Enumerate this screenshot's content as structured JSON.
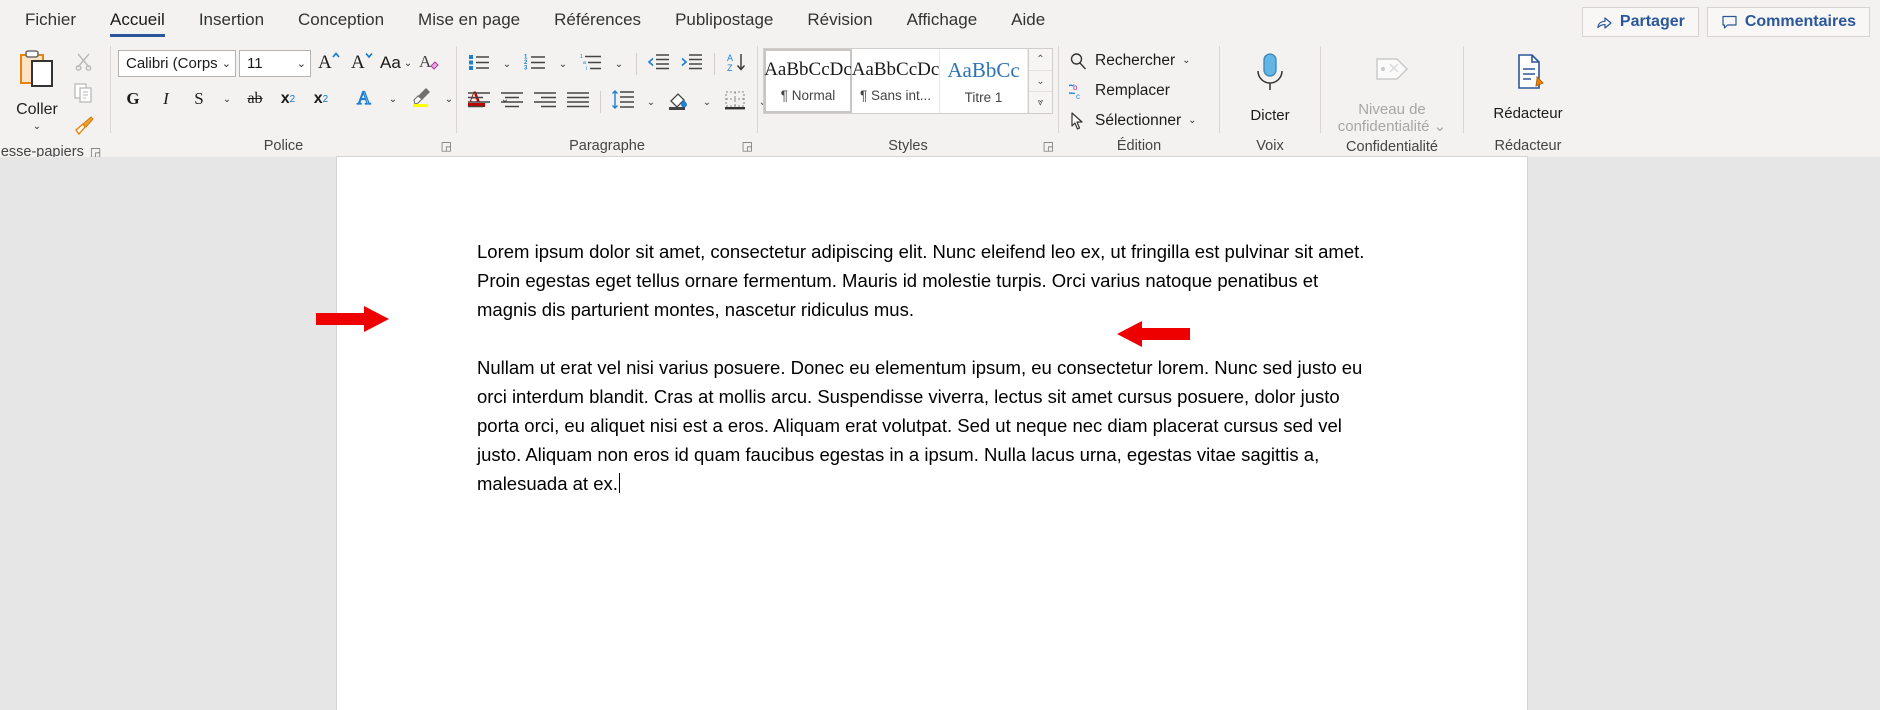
{
  "tabs": [
    {
      "label": "Fichier",
      "active": false
    },
    {
      "label": "Accueil",
      "active": true
    },
    {
      "label": "Insertion",
      "active": false
    },
    {
      "label": "Conception",
      "active": false
    },
    {
      "label": "Mise en page",
      "active": false
    },
    {
      "label": "Références",
      "active": false
    },
    {
      "label": "Publipostage",
      "active": false
    },
    {
      "label": "Révision",
      "active": false
    },
    {
      "label": "Affichage",
      "active": false
    },
    {
      "label": "Aide",
      "active": false
    }
  ],
  "titlebar_buttons": {
    "share": "Partager",
    "share_icon": "share-icon",
    "comments": "Commentaires",
    "comments_icon": "comment-bubble-icon"
  },
  "ribbon": {
    "clipboard": {
      "group_label": "esse-papiers",
      "paste_label": "Coller",
      "paste_icon": "paste-clipboard-icon",
      "paste_caret": "⌄",
      "cut_icon": "scissors-icon",
      "copy_icon": "copy-icon",
      "format_painter_icon": "format-painter-icon",
      "dialog_launcher": "◲"
    },
    "font": {
      "group_label": "Police",
      "font_name": "Calibri (Corps)",
      "font_size": "11",
      "grow_font_icon": "grow-font-icon",
      "shrink_font_icon": "shrink-font-icon",
      "change_case_label": "Aa",
      "change_case_icon": "change-case-icon",
      "clear_format_icon": "clear-formatting-icon",
      "bold_label": "G",
      "italic_label": "I",
      "underline_label": "S",
      "strikethrough_label": "ab",
      "subscript_label": "x",
      "subscript_sub": "2",
      "superscript_label": "x",
      "superscript_sup": "2",
      "text_effects_label": "A",
      "text_effects_icon": "text-effects-icon",
      "highlight_icon": "highlight-color-icon",
      "font_color_label": "A",
      "font_color_icon": "font-color-icon",
      "dialog_launcher": "◲"
    },
    "paragraph": {
      "group_label": "Paragraphe",
      "bullets_icon": "bullet-list-icon",
      "numbering_icon": "numbered-list-icon",
      "multilevel_icon": "multilevel-list-icon",
      "decrease_indent_icon": "decrease-indent-icon",
      "increase_indent_icon": "increase-indent-icon",
      "sort_icon": "sort-az-icon",
      "show_marks_label": "¶",
      "show_marks_icon": "show-paragraph-marks-icon",
      "align_left_icon": "align-left-icon",
      "align_center_icon": "align-center-icon",
      "align_right_icon": "align-right-icon",
      "align_justify_icon": "align-justify-icon",
      "line_spacing_icon": "line-spacing-icon",
      "shading_icon": "shading-icon",
      "borders_icon": "borders-icon",
      "dialog_launcher": "◲"
    },
    "styles": {
      "group_label": "Styles",
      "items": [
        {
          "preview": "AaBbCcDc",
          "name": "¶ Normal",
          "selected": true,
          "blue": false
        },
        {
          "preview": "AaBbCcDc",
          "name": "¶ Sans int...",
          "selected": false,
          "blue": false
        },
        {
          "preview": "AaBbCc",
          "name": "Titre 1",
          "selected": false,
          "blue": true
        }
      ],
      "scroll_up": "⌃",
      "scroll_down": "⌄",
      "more": "⩔",
      "dialog_launcher": "◲"
    },
    "editing": {
      "group_label": "Édition",
      "find_label": "Rechercher",
      "find_icon": "search-icon",
      "find_caret": "⌄",
      "replace_label": "Remplacer",
      "replace_icon": "replace-icon",
      "select_label": "Sélectionner",
      "select_icon": "cursor-arrow-icon",
      "select_caret": "⌄"
    },
    "voice": {
      "group_label": "Voix",
      "dictate_label": "Dicter",
      "dictate_icon": "microphone-icon"
    },
    "confidentiality": {
      "group_label": "Confidentialité",
      "sensitivity_label": "Niveau de confidentialité",
      "sensitivity_icon": "sensitivity-label-icon",
      "caret": "⌄"
    },
    "editor": {
      "group_label": "Rédacteur",
      "editor_label": "Rédacteur",
      "editor_icon": "editor-pencil-icon"
    }
  },
  "document": {
    "paragraph1": "Lorem ipsum dolor sit amet, consectetur adipiscing elit. Nunc eleifend leo ex, ut fringilla est pulvinar sit amet. Proin egestas eget tellus ornare fermentum. Mauris id molestie turpis. Orci varius natoque penatibus et magnis dis parturient montes, nascetur ridiculus mus.",
    "paragraph2": "Nullam ut erat vel nisi varius posuere. Donec eu elementum ipsum, eu consectetur lorem. Nunc sed justo eu orci interdum blandit. Cras at mollis arcu. Suspendisse viverra, lectus sit amet cursus posuere, dolor justo porta orci, eu aliquet nisi est a eros. Aliquam erat volutpat. Sed ut neque nec diam placerat cursus sed vel justo. Aliquam non eros id quam faucibus egestas in a ipsum. Nulla lacus urna, egestas vitae sagittis a, malesuada at ex."
  },
  "annotations": {
    "arrow_color": "#ee0000",
    "left_arrow": "arrow-pointing-right",
    "right_arrow": "arrow-pointing-left"
  },
  "colors": {
    "ribbon_bg": "#f3f2f1",
    "accent": "#2b579a",
    "page_bg": "#ffffff",
    "canvas_bg": "#e6e6e6"
  }
}
